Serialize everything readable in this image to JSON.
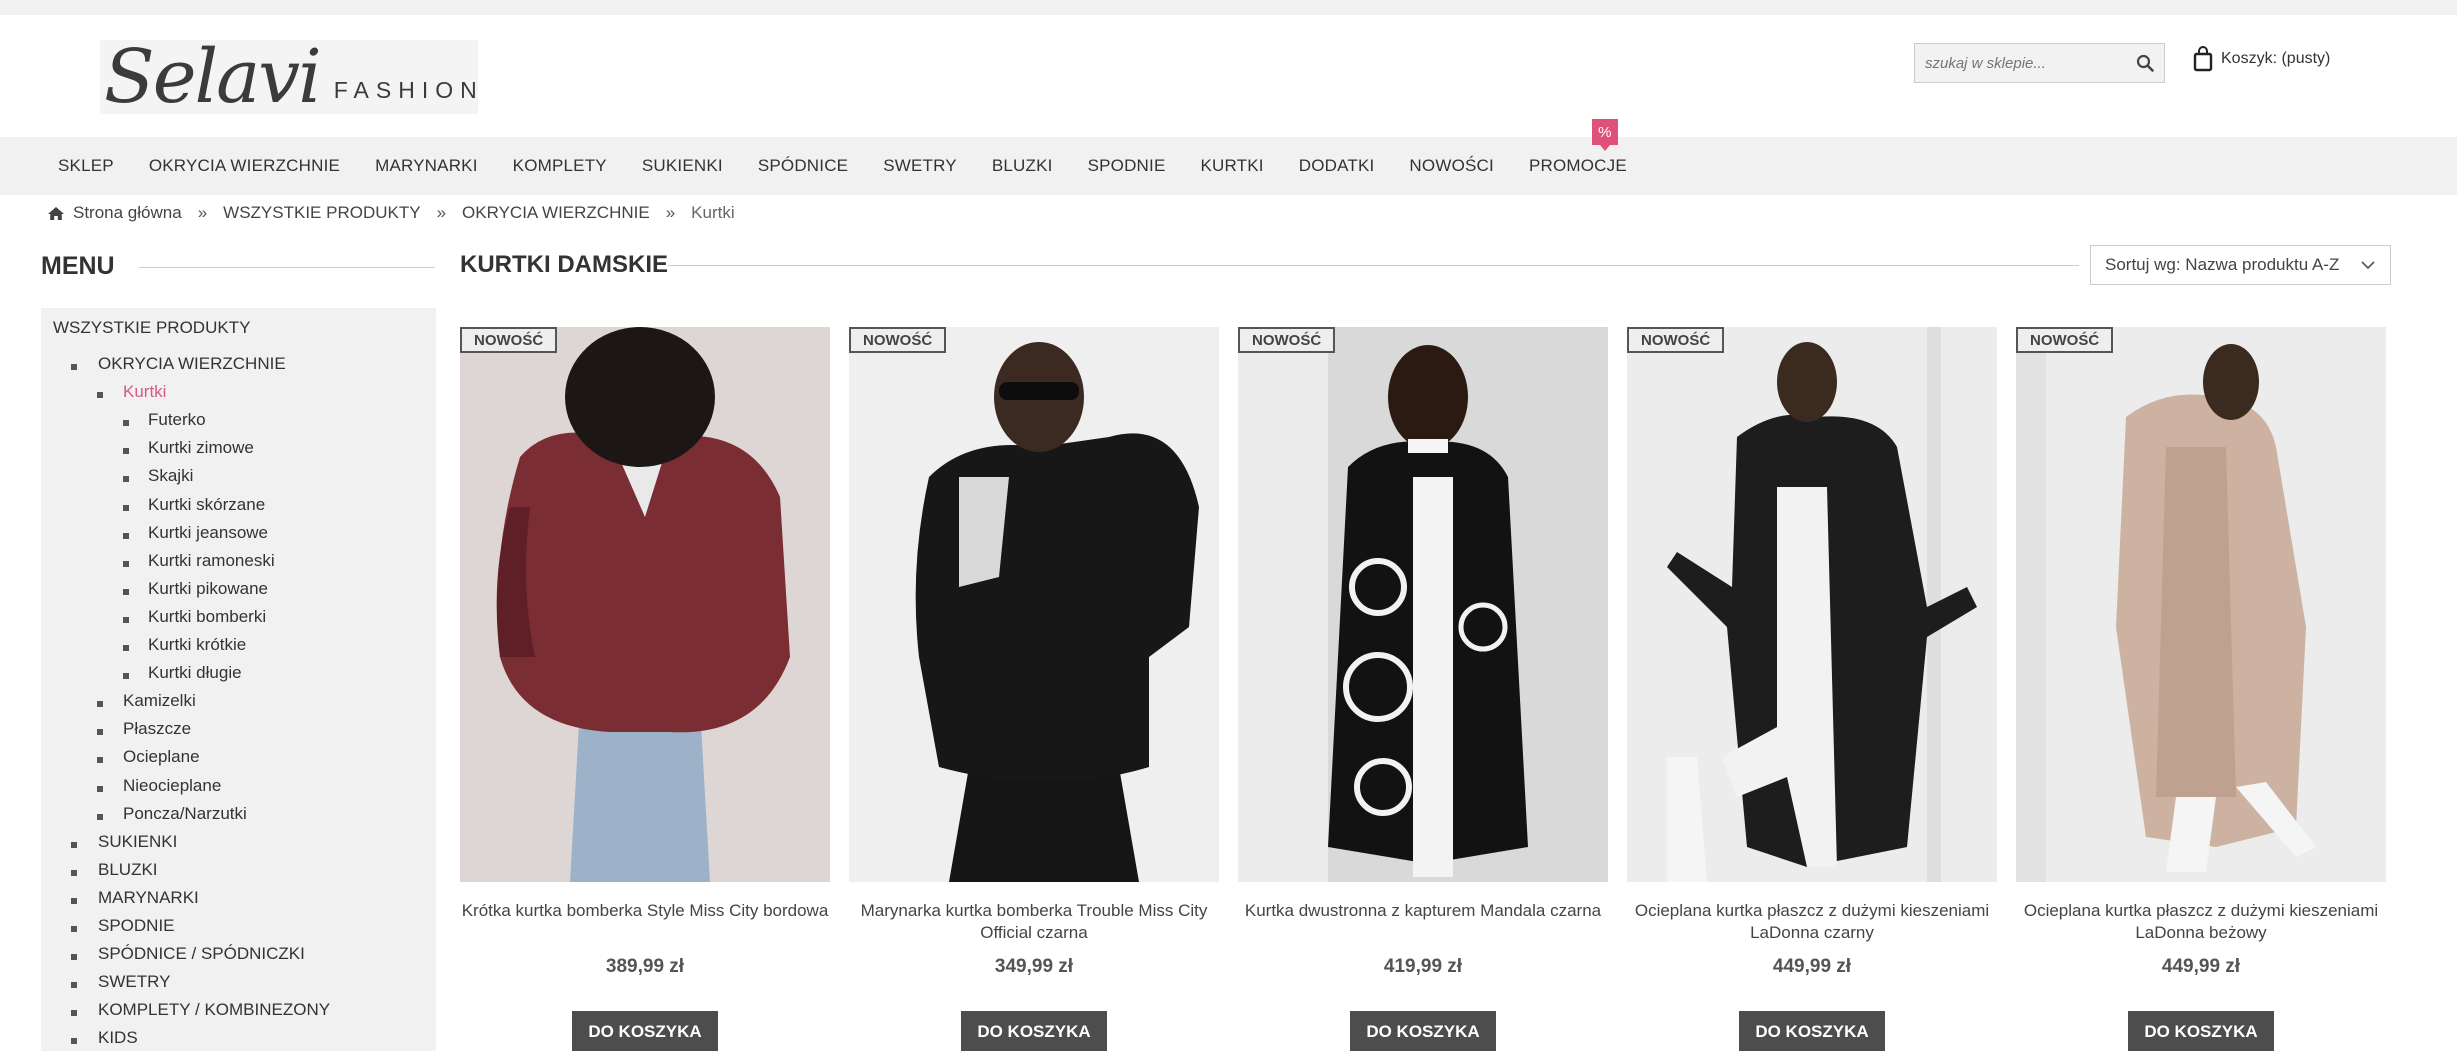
{
  "header": {
    "logo_script": "Selavi",
    "logo_word": "FASHION",
    "search_placeholder": "szukaj w sklepie...",
    "cart_label": "Koszyk: (pusty)"
  },
  "nav": {
    "items": [
      "SKLEP",
      "OKRYCIA WIERZCHNIE",
      "MARYNARKI",
      "KOMPLETY",
      "SUKIENKI",
      "SPÓDNICE",
      "SWETRY",
      "BLUZKI",
      "SPODNIE",
      "KURTKI",
      "DODATKI",
      "NOWOŚCI",
      "PROMOCJE"
    ],
    "promo_badge": "%"
  },
  "breadcrumb": {
    "home": "Strona główna",
    "sep": "»",
    "level1": "WSZYSTKIE PRODUKTY",
    "level2": "OKRYCIA WIERZCHNIE",
    "current": "Kurtki"
  },
  "sidebar": {
    "title": "MENU",
    "root": "WSZYSTKIE PRODUKTY",
    "outerwear": "OKRYCIA WIERZCHNIE",
    "active": "Kurtki",
    "jackets": [
      "Futerko",
      "Kurtki zimowe",
      "Skajki",
      "Kurtki skórzane",
      "Kurtki jeansowe",
      "Kurtki ramoneski",
      "Kurtki pikowane",
      "Kurtki bomberki",
      "Kurtki krótkie",
      "Kurtki długie"
    ],
    "outerwear_other": [
      "Kamizelki",
      "Płaszcze",
      "Ocieplane",
      "Nieocieplane",
      "Poncza/Narzutki"
    ],
    "top_categories": [
      "SUKIENKI",
      "BLUZKI",
      "MARYNARKI",
      "SPODNIE",
      "SPÓDNICE / SPÓDNICZKI",
      "SWETRY",
      "KOMPLETY / KOMBINEZONY",
      "KIDS"
    ]
  },
  "main": {
    "title": "KURTKI DAMSKIE",
    "sort_label": "Sortuj wg: Nazwa produktu A-Z",
    "new_badge": "NOWOŚĆ",
    "add_to_cart": "DO KOSZYKA",
    "products": [
      {
        "name": "Krótka kurtka bomberka Style Miss City bordowa",
        "price": "389,99 zł"
      },
      {
        "name": "Marynarka kurtka bomberka Trouble Miss City Official czarna",
        "price": "349,99 zł"
      },
      {
        "name": "Kurtka dwustronna z kapturem Mandala czarna",
        "price": "419,99 zł"
      },
      {
        "name": "Ocieplana kurtka płaszcz z dużymi kieszeniami LaDonna czarny",
        "price": "449,99 zł"
      },
      {
        "name": "Ocieplana kurtka płaszcz z dużymi kieszeniami LaDonna beżowy",
        "price": "449,99 zł"
      }
    ]
  },
  "colors": {
    "accent_pink": "#d95a84",
    "badge_pink": "#e0517a",
    "button_dark": "#4d4d4d",
    "light_gray": "#f1f1f1"
  },
  "icons": {
    "breadcrumb_home": "home-icon",
    "search": "search-icon",
    "cart": "shopping-bag-icon",
    "sort": "chevron-down-icon"
  }
}
